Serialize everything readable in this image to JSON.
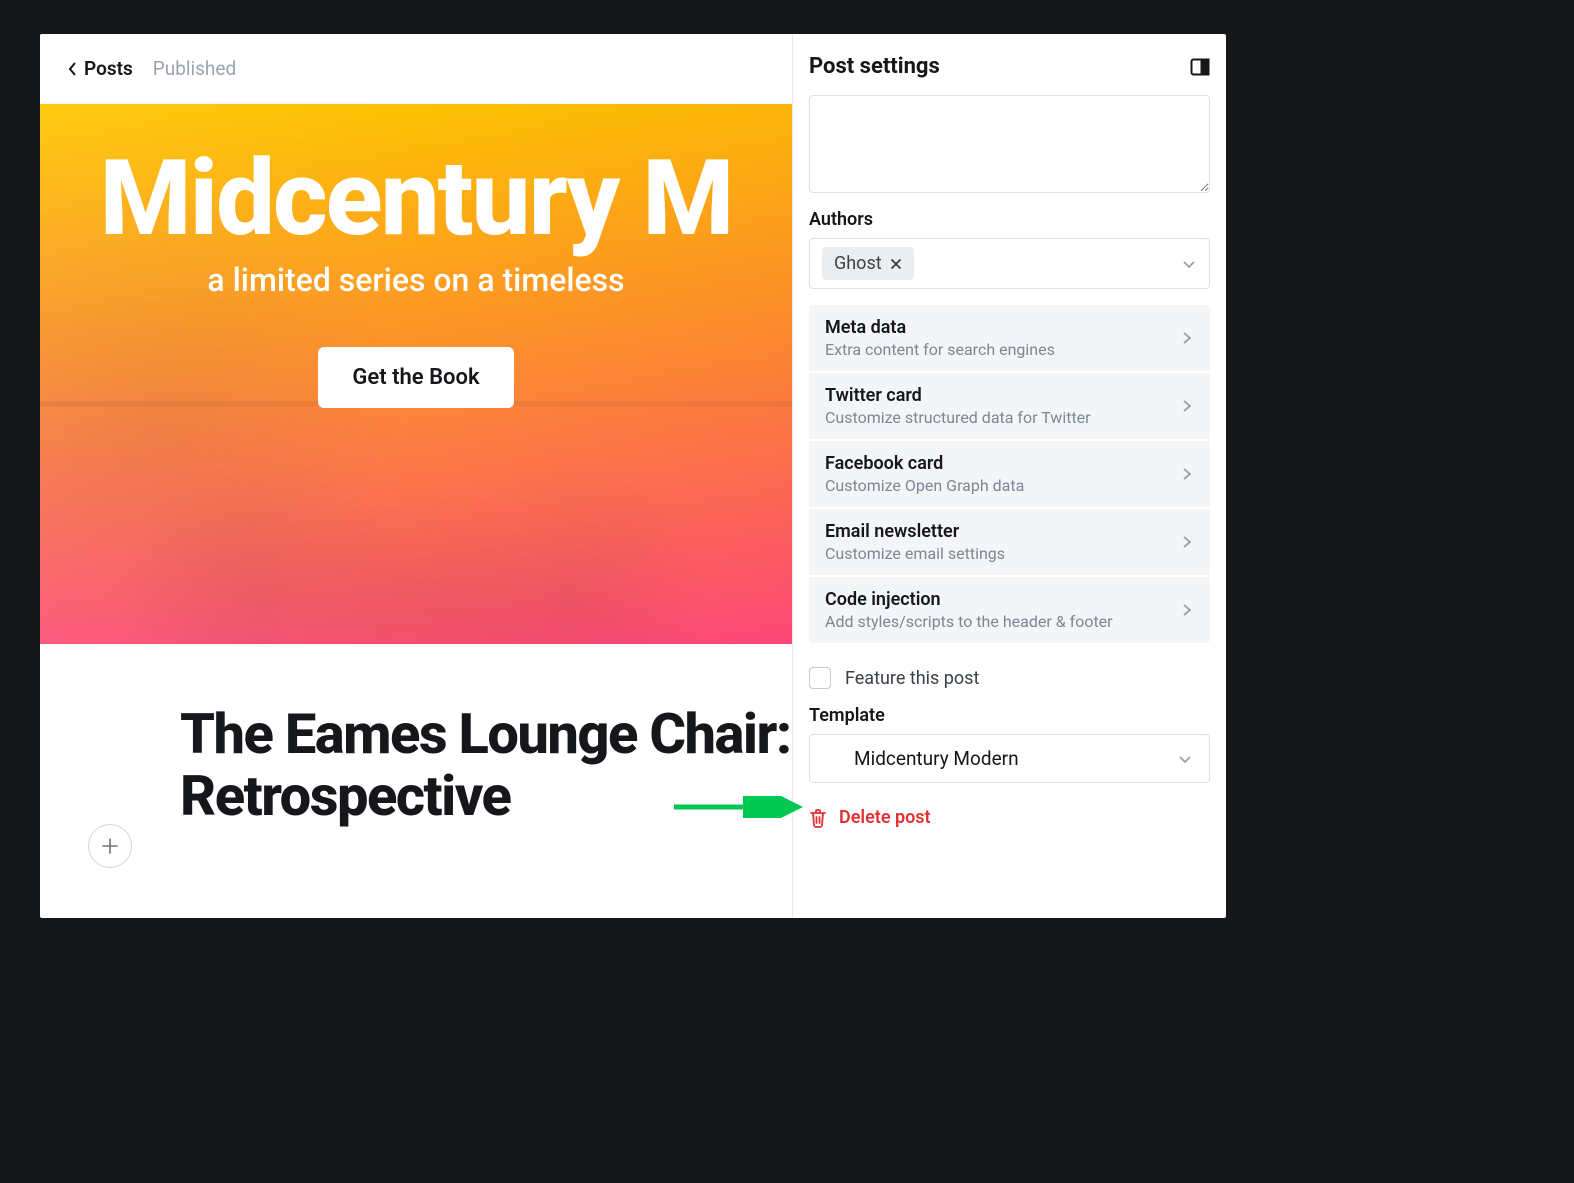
{
  "topbar": {
    "back": "Posts",
    "status": "Published"
  },
  "hero": {
    "title": "Midcentury M",
    "subtitle": "a limited series on a timeless",
    "button": "Get the Book"
  },
  "post": {
    "title": "The Eames Lounge Chair: Retrospective"
  },
  "sidebar": {
    "title": "Post settings",
    "excerpt_value": "",
    "authors_label": "Authors",
    "author_chip": "Ghost",
    "meta_items": [
      {
        "title": "Meta data",
        "desc": "Extra content for search engines"
      },
      {
        "title": "Twitter card",
        "desc": "Customize structured data for Twitter"
      },
      {
        "title": "Facebook card",
        "desc": "Customize Open Graph data"
      },
      {
        "title": "Email newsletter",
        "desc": "Customize email settings"
      },
      {
        "title": "Code injection",
        "desc": "Add styles/scripts to the header & footer"
      }
    ],
    "feature_label": "Feature this post",
    "template_label": "Template",
    "template_value": "Midcentury Modern",
    "delete_label": "Delete post"
  }
}
